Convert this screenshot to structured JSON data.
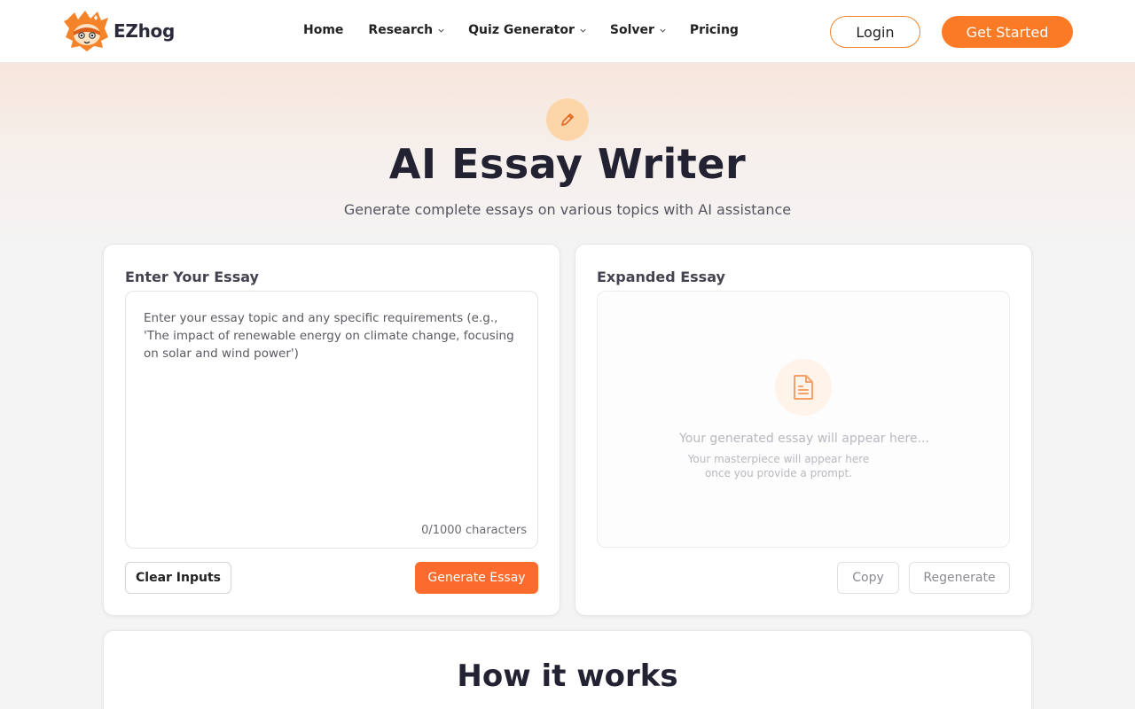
{
  "header": {
    "brand": "EZhog",
    "nav": [
      {
        "label": "Home",
        "dropdown": false
      },
      {
        "label": "Research",
        "dropdown": true
      },
      {
        "label": "Quiz Generator",
        "dropdown": true
      },
      {
        "label": "Solver",
        "dropdown": true
      },
      {
        "label": "Pricing",
        "dropdown": false
      }
    ],
    "login_label": "Login",
    "get_started_label": "Get Started"
  },
  "hero": {
    "icon": "pencil-icon",
    "title": "AI Essay Writer",
    "subtitle": "Generate complete essays on various topics with AI assistance"
  },
  "input_card": {
    "title": "Enter Your Essay",
    "value": "",
    "placeholder": "Enter your essay topic and any specific requirements (e.g., 'The impact of renewable energy on climate change, focusing on solar and wind power')",
    "char_count": "0/1000 characters",
    "clear_label": "Clear Inputs",
    "generate_label": "Generate Essay"
  },
  "output_card": {
    "title": "Expanded Essay",
    "icon": "document-icon",
    "placeholder_title": "Your generated essay will appear here...",
    "placeholder_sub_line1": "Your masterpiece will appear here",
    "placeholder_sub_line2": "once you provide a prompt.",
    "copy_label": "Copy",
    "regenerate_label": "Regenerate"
  },
  "how_it_works": {
    "title": "How it works"
  },
  "colors": {
    "accent": "#fb7a26",
    "generate": "#fb6b2d",
    "hero_icon_bg": "#fcd6a8"
  }
}
